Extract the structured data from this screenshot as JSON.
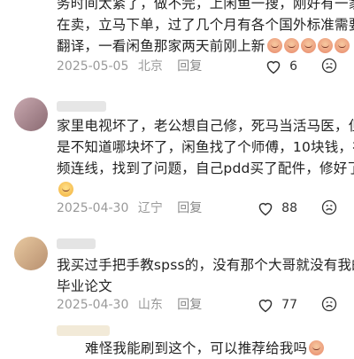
{
  "comments": [
    {
      "lines": [
        "务时间太紧了，做不完，上闲鱼一搜，刚好有一家",
        "在卖，立马下单，过了几个月有各个国外标准需要",
        "翻译，一看闲鱼那家两天前刚上新"
      ],
      "date": "2025-05-05",
      "location": "北京",
      "reply": "回复",
      "likes": "6"
    },
    {
      "lines": [
        "家里电视坏了，老公想自己修，死马当活马医，但",
        "是不知道哪块坏了，闲鱼找了个师傅，10块钱，视",
        "频连线，找到了问题，自己pdd买了配件，修好了"
      ],
      "date": "2025-04-30",
      "location": "辽宁",
      "reply": "回复",
      "likes": "88"
    },
    {
      "lines": [
        "我买过手把手教spss的，没有那个大哥就没有我的",
        "毕业论文"
      ],
      "date": "2025-04-30",
      "location": "山东",
      "reply": "回复",
      "likes": "77"
    },
    {
      "lines": [
        "难怪我能刷到这个，可以推荐给我吗"
      ]
    }
  ],
  "icons": {
    "like": "heart-outline-icon",
    "dislike": "dislike-icon",
    "emoji_a": "peach-emoji-icon",
    "emoji_b": "laughing-emoji-icon"
  },
  "colors": {
    "meta": "#999999",
    "text": "#222222"
  }
}
